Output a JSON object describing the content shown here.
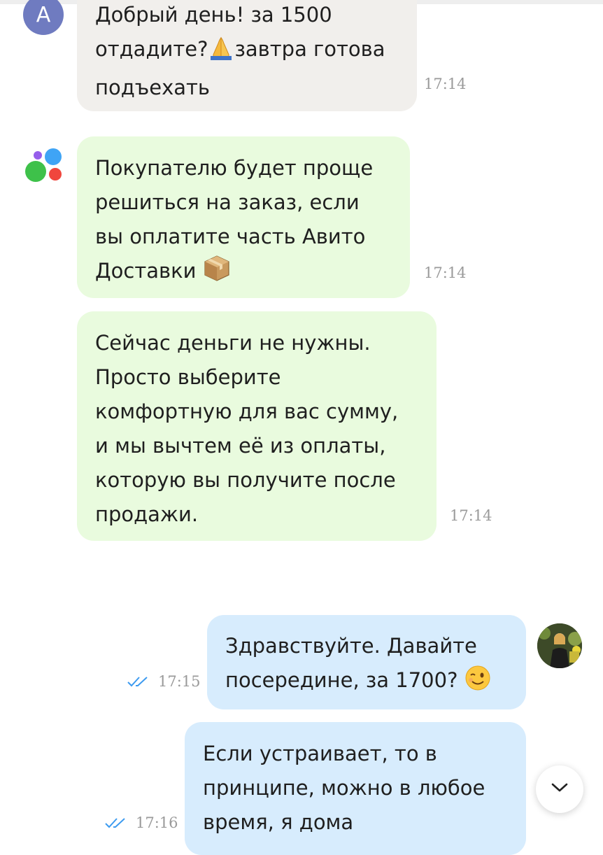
{
  "messages": [
    {
      "text_line1": "Добрый день! за 1500",
      "text_line2a": "отдадите?",
      "text_line2b": "завтра готова",
      "text_line3": "подъехать",
      "time": "17:14",
      "sender_initial": "А"
    },
    {
      "text_line1": "Покупателю будет проще",
      "text_line2": "решиться на заказ, если",
      "text_line3": "вы оплатите часть Авито",
      "text_line4": "Доставки",
      "time": "17:14"
    },
    {
      "text": "Сейчас деньги не нужны.\nПросто выберите\nкомфортную для вас сумму,\nи мы вычтем её из оплаты,\nкоторую вы получите после\nпродажи.",
      "time": "17:14"
    },
    {
      "text_line1": "Здравствуйте. Давайте",
      "text_line2": "посередине, за 1700?",
      "time": "17:15"
    },
    {
      "text": "Если устраивает, то в\nпринципе, можно в любое\nвремя, я дома",
      "time": "17:16"
    }
  ],
  "icons": {
    "prayer": "folded-hands-emoji",
    "package": "package-emoji",
    "wink": "winking-face-emoji",
    "read": "double-check-icon",
    "scroll": "chevron-down-icon"
  },
  "colors": {
    "incoming_bubble": "#f1efec",
    "system_bubble": "#e9fbde",
    "outgoing_bubble": "#d7ecfd",
    "read_check": "#3d9bf0"
  }
}
